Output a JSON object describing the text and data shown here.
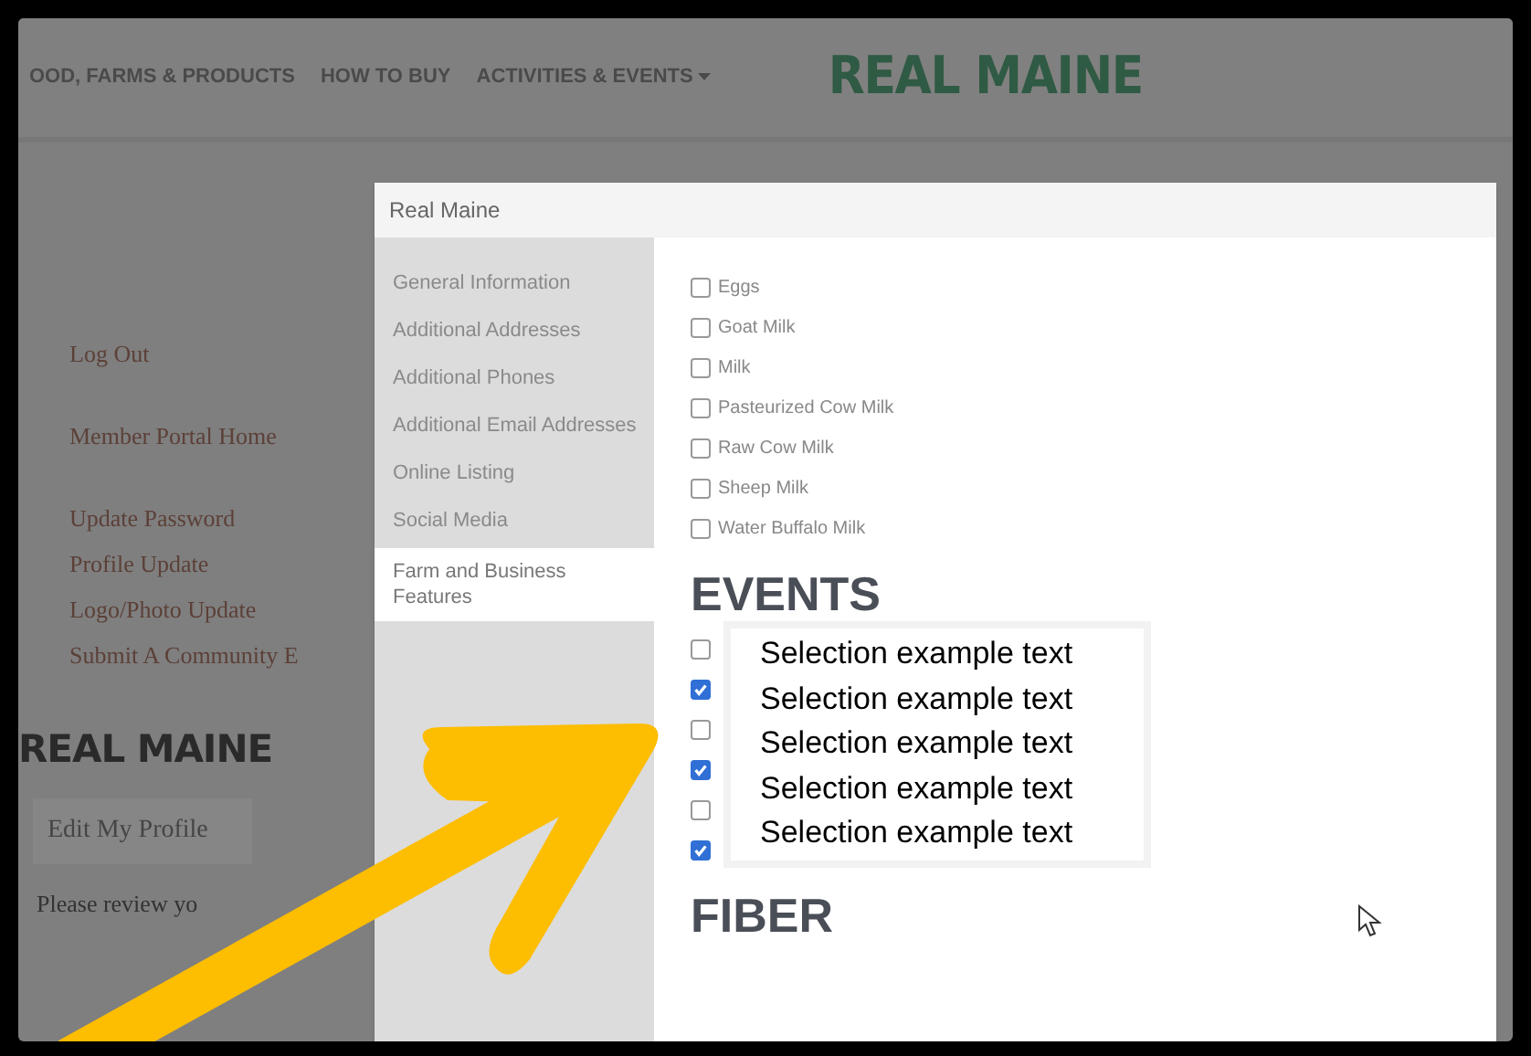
{
  "nav": {
    "items": [
      {
        "label": "OOD, FARMS & PRODUCTS",
        "dropdown": false
      },
      {
        "label": "HOW TO BUY",
        "dropdown": false
      },
      {
        "label": "ACTIVITIES & EVENTS",
        "dropdown": true
      }
    ],
    "logo": "REAL MAINE"
  },
  "member_menu": {
    "link_groups": [
      [
        "Log Out"
      ],
      [
        "Member Portal Home"
      ],
      [
        "Update Password",
        "Profile Update",
        "Logo/Photo Update",
        "Submit A Community E"
      ]
    ],
    "heading": "REAL MAINE",
    "button": "Edit My Profile",
    "note": "Please review yo"
  },
  "modal": {
    "title": "Real Maine",
    "sidebar": {
      "items": [
        {
          "label": "General Information",
          "selected": false
        },
        {
          "label": "Additional Addresses",
          "selected": false
        },
        {
          "label": "Additional Phones",
          "selected": false
        },
        {
          "label": "Additional Email Addresses",
          "selected": false
        },
        {
          "label": "Online Listing",
          "selected": false
        },
        {
          "label": "Social Media",
          "selected": false
        },
        {
          "label": "Farm and Business Features",
          "selected": true
        }
      ]
    },
    "sections": [
      {
        "options": [
          {
            "label": "Eggs",
            "checked": false
          },
          {
            "label": "Goat Milk",
            "checked": false
          },
          {
            "label": "Milk",
            "checked": false
          },
          {
            "label": "Pasteurized Cow Milk",
            "checked": false
          },
          {
            "label": "Raw Cow Milk",
            "checked": false
          },
          {
            "label": "Sheep Milk",
            "checked": false
          },
          {
            "label": "Water Buffalo Milk",
            "checked": false
          }
        ]
      },
      {
        "heading": "EVENTS",
        "options": [
          {
            "checked": false
          },
          {
            "checked": true
          },
          {
            "checked": false
          },
          {
            "checked": true
          },
          {
            "checked": false
          },
          {
            "checked": true
          }
        ],
        "callout": [
          "Selection example text",
          "Selection example text",
          "Selection example text",
          "Selection example text",
          "Selection example text"
        ]
      },
      {
        "heading": "FIBER"
      }
    ]
  }
}
